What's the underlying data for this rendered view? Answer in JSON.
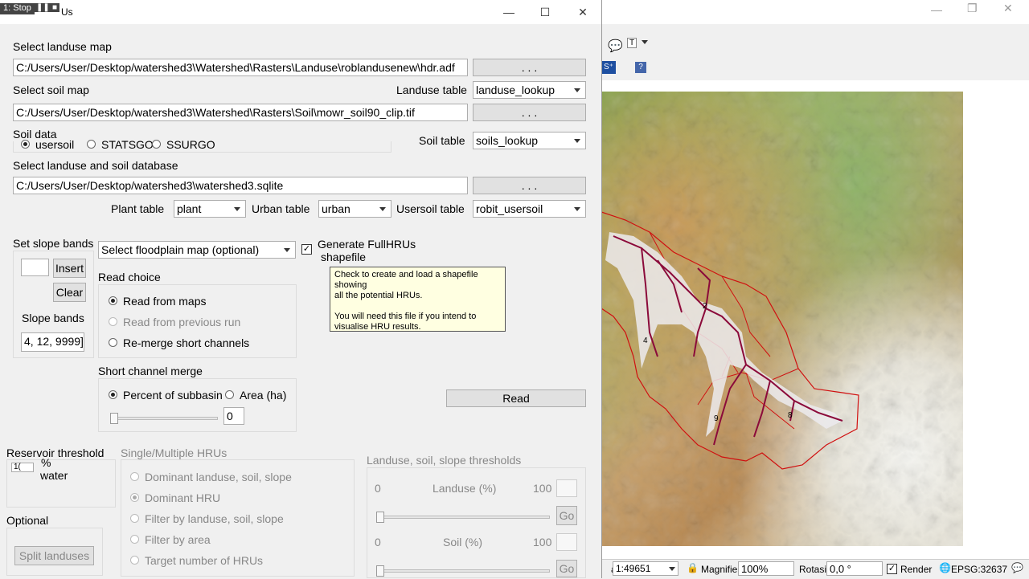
{
  "dialog": {
    "title": "Us",
    "recorder_tag": "1: Stop",
    "landuse": {
      "label": "Select landuse map",
      "path": "C:/Users/User/Desktop/watershed3\\Watershed\\Rasters\\Landuse\\roblandusenew\\hdr.adf",
      "browse": ". . .",
      "table_label": "Landuse table",
      "table_value": "landuse_lookup"
    },
    "soil": {
      "label": "Select soil map",
      "path": "C:/Users/User/Desktop/watershed3\\Watershed\\Rasters\\Soil\\mowr_soil90_clip.tif",
      "browse": ". . .",
      "data_label": "Soil data",
      "options": [
        "usersoil",
        "STATSGO",
        "SSURGO/S"
      ],
      "table_label": "Soil table",
      "table_value": "soils_lookup"
    },
    "database": {
      "label": "Select landuse and soil database",
      "path": "C:/Users/User/Desktop/watershed3\\watershed3.sqlite",
      "browse": ". . .",
      "plant_label": "Plant table",
      "plant_value": "plant",
      "urban_label": "Urban table",
      "urban_value": "urban",
      "usersoil_label": "Usersoil table",
      "usersoil_value": "robit_usersoil"
    },
    "slope": {
      "label": "Set slope bands (",
      "insert": "Insert",
      "clear": "Clear",
      "bands_label": "Slope bands",
      "bands_value": "4, 12, 9999]"
    },
    "floodplain": {
      "value": "Select floodplain map (optional)",
      "generate_label_1": "Generate FullHRUs",
      "generate_label_2": "shapefile"
    },
    "tooltip": {
      "line1": "Check to create and load a shapefile showing",
      "line2": "all the potential HRUs.",
      "line3": "You will need this file if you intend to",
      "line4": "visualise HRU results."
    },
    "read_choice": {
      "label": "Read choice",
      "options": [
        "Read from maps",
        "Read from previous run",
        "Re-merge short channels"
      ]
    },
    "short_channel": {
      "label": "Short channel merge",
      "percent": "Percent of subbasin",
      "area": "Area (ha)",
      "value": "0"
    },
    "read_button": "Read",
    "reservoir": {
      "label": "Reservoir threshold",
      "spin": "1(",
      "unit1": "%",
      "unit2": "water"
    },
    "optional": {
      "label": "Optional",
      "split": "Split landuses"
    },
    "hru": {
      "label": "Single/Multiple HRUs",
      "options": [
        "Dominant landuse, soil, slope",
        "Dominant HRU",
        "Filter by landuse, soil, slope",
        "Filter by area",
        "Target number of HRUs"
      ]
    },
    "thresholds": {
      "label": "Landuse, soil, slope thresholds",
      "landuse_min": "0",
      "landuse_label": "Landuse (%)",
      "landuse_max": "100",
      "soil_min": "0",
      "soil_label": "Soil (%)",
      "soil_max": "100",
      "go": "Go"
    }
  },
  "qgis": {
    "scale_label": "a",
    "scale_value": "1:49651",
    "magnifier_label": "Magnifier",
    "magnifier_value": "100%",
    "rotation_label": "Rotasi",
    "rotation_value": "0,0 °",
    "render_label": "Render",
    "crs": "EPSG:32637",
    "map_labels": [
      "2",
      "4",
      "9",
      "8"
    ],
    "colors": {
      "accent": "#d01010",
      "stream": "#8b0a3a"
    }
  }
}
